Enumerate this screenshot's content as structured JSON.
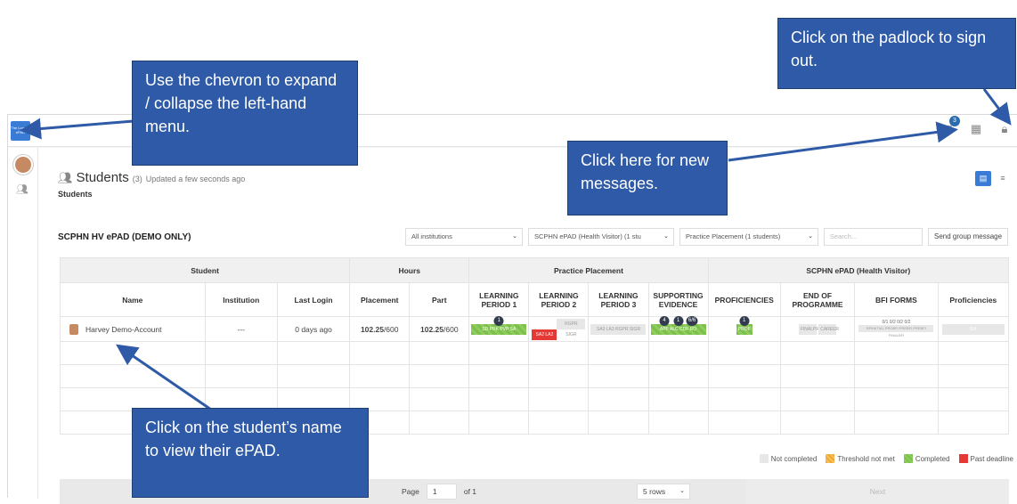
{
  "app": {
    "logo_text": "The London ePAD"
  },
  "header": {
    "messages_count": "3"
  },
  "page": {
    "title": "Students",
    "title_count": "(3)",
    "updated": "Updated a few seconds ago",
    "breadcrumb": "Students",
    "section": "SCPHN HV ePAD (DEMO ONLY)"
  },
  "filters": {
    "institutions": "All institutions",
    "epad": "SCPHN ePAD (Health Visitor) (1 stu",
    "placement": "Practice Placement (1 students)",
    "search_placeholder": "Search...",
    "send_group": "Send group message"
  },
  "table": {
    "groups": [
      "Student",
      "Hours",
      "Practice Placement",
      "SCPHN ePAD (Health Visitor)"
    ],
    "columns": [
      "Name",
      "Institution",
      "Last Login",
      "Placement",
      "Part",
      "LEARNING PERIOD 1",
      "LEARNING PERIOD 2",
      "LEARNING PERIOD 3",
      "SUPPORTING EVIDENCE",
      "PROFICIENCIES",
      "END OF PROGRAMME",
      "BFI FORMS",
      "Proficiencies"
    ],
    "row": {
      "name": "Harvey Demo-Account",
      "institution": "---",
      "last_login": "0 days ago",
      "placement_done": "102.25",
      "placement_total": "/600",
      "part_done": "102.25",
      "part_total": "/600",
      "lp1_count": "1",
      "lp1_text": "SD PRK PVP SA",
      "lp2_text_red": "SA2 LA2",
      "lp2_text_grey": "RGPR SIGR",
      "lp3_text": "SA3 LA3 RGPR SIGR",
      "se_count_a": "4",
      "se_count_b": "1",
      "se_count_c": "6/6",
      "se_text": "APP ALC CDF RO",
      "prof_count": "1",
      "prof_text": "PROF",
      "eop_a": "FINALPRO",
      "eop_b": "CAREER",
      "bfi_counts": "0/1  0/2  0/2  0/2",
      "bfi_text": "BFIINITIAL PROBFI PREBFI PREBFI FINALBFI",
      "proficiencies_text": "S/4"
    }
  },
  "pager": {
    "page_label": "Page",
    "page_value": "1",
    "of": "of 1",
    "rows": "5 rows",
    "next": "Next"
  },
  "legend": {
    "not_completed": "Not completed",
    "threshold": "Threshold not met",
    "completed": "Completed",
    "past_deadline": "Past deadline"
  },
  "callouts": {
    "padlock": "Click on the padlock to sign out.",
    "chevron": "Use the chevron to expand / collapse the left-hand menu.",
    "messages": "Click here for new messages.",
    "student": "Click on the student’s name to view their ePAD."
  },
  "colors": {
    "accent": "#3a7bd5",
    "callout": "#2e5aa8",
    "completed": "#7cbf4c",
    "threshold": "#f0a830",
    "past_deadline": "#e53935",
    "not_completed": "#e7e7e7"
  }
}
